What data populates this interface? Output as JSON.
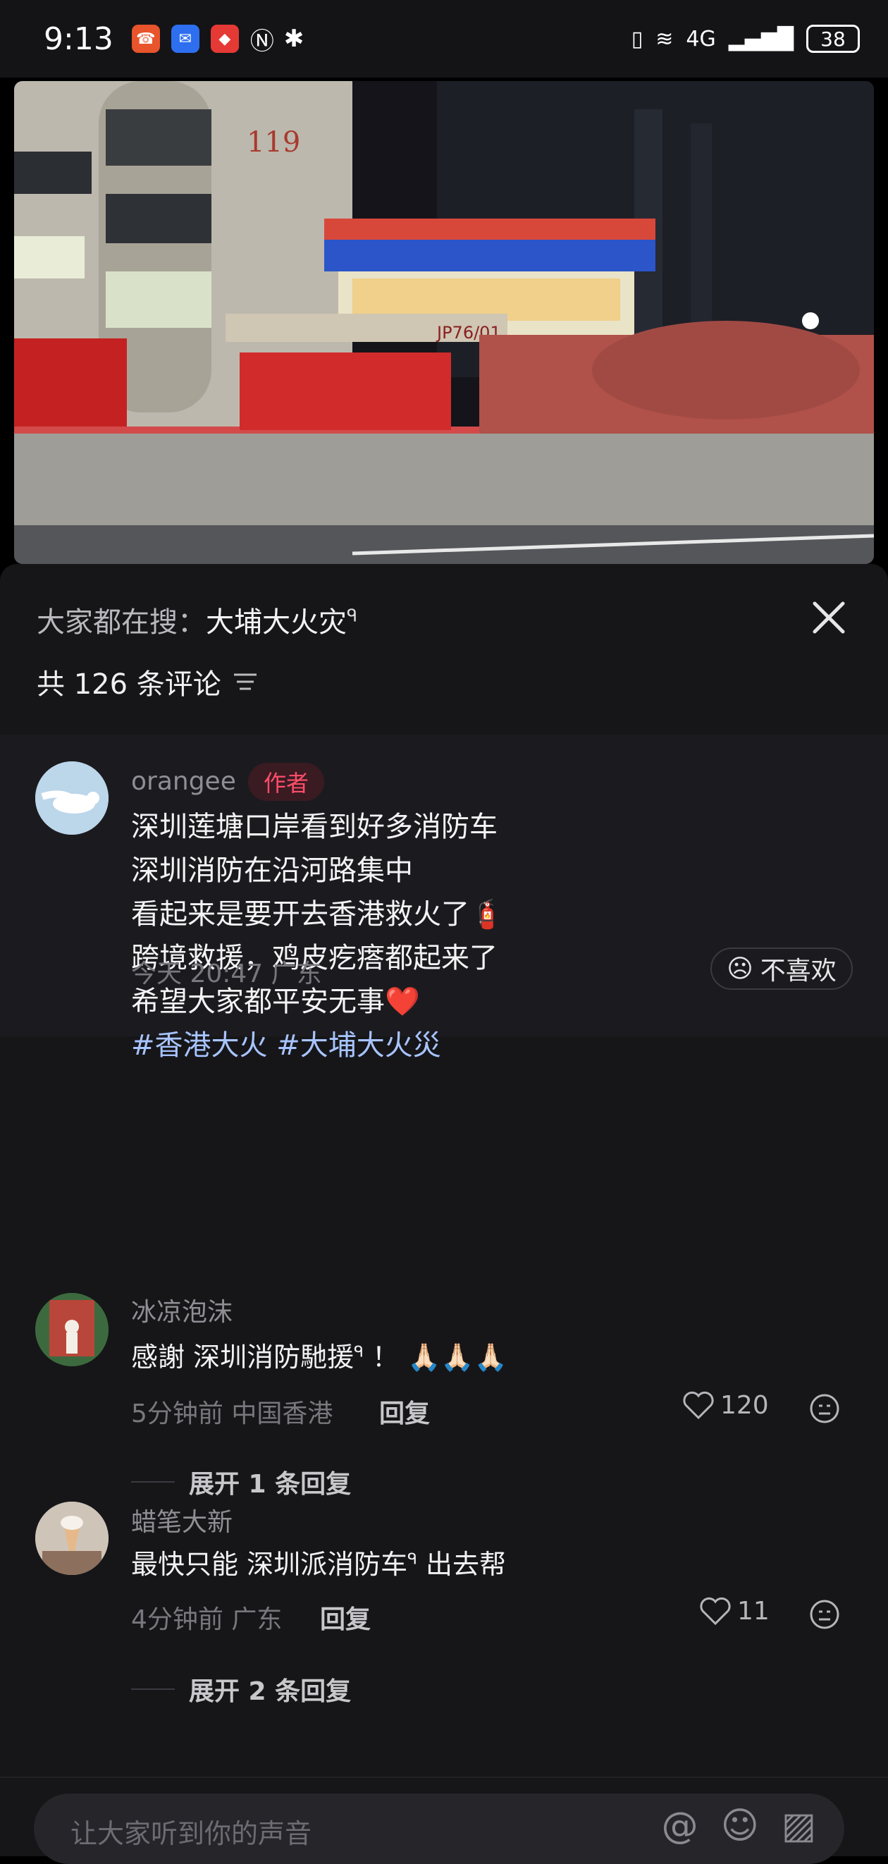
{
  "status_bar": {
    "time": "9:13",
    "battery": "38",
    "network": "4G",
    "signal_label": "6"
  },
  "video": {
    "building_number": "119",
    "truck_plate": "JP76/01"
  },
  "header": {
    "trending_prefix": "大家都在搜：",
    "trending_keyword": "大埔大火灾",
    "comment_count_label": "共 126 条评论"
  },
  "author_comment": {
    "username": "orangee",
    "badge": "作者",
    "lines": [
      "深圳莲塘口岸看到好多消防车",
      "深圳消防在沿河路集中",
      "看起来是要开去香港救火了🧯",
      "跨境救援，鸡皮疙瘩都起来了",
      "希望大家都平安无事❤️"
    ],
    "hashtags": "#香港大火 #大埔大火災",
    "time": "今天 20:47 广东",
    "dislike_label": "不喜欢"
  },
  "comments": [
    {
      "username": "冰凉泡沫",
      "text_before": "感謝 ",
      "link": "深圳消防馳援",
      "text_after": " ！ 🙏🏻🙏🏻🙏🏻",
      "meta": "5分钟前 中国香港",
      "reply_label": "回复",
      "likes": "120",
      "expand_label": "展开 1 条回复"
    },
    {
      "username": "蜡笔大新",
      "text_before": "最快只能 ",
      "link": "深圳派消防车",
      "text_after": " 出去帮",
      "meta": "4分钟前 广东",
      "reply_label": "回复",
      "likes": "11",
      "expand_label": "展开 2 条回复"
    }
  ],
  "input": {
    "placeholder": "让大家听到你的声音"
  },
  "colors": {
    "accent_author": "#ff4d6a",
    "hashtag": "#a8c4ff",
    "sheet_bg": "#161619"
  }
}
